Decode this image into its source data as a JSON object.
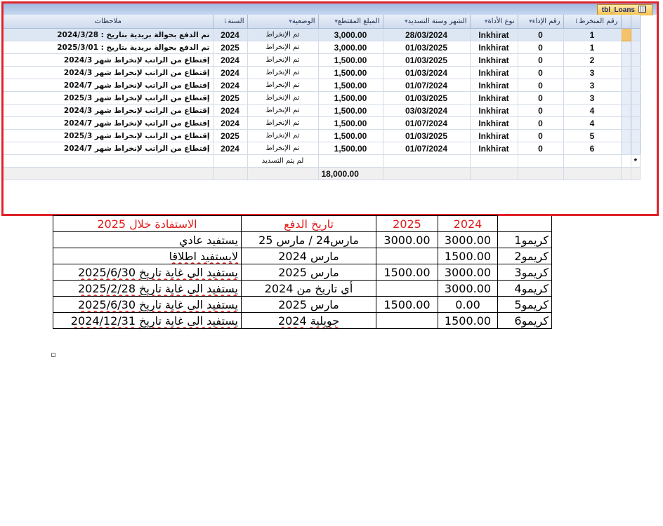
{
  "access": {
    "tab_title": "tbl_Loans",
    "columns": [
      "ملاحظات",
      "السنة",
      "الوضعية",
      "المبلغ المقتطع",
      "الشهر وسنة التسديد",
      "نوع الأداة",
      "رقم الإداء",
      "رقم المنخرط"
    ],
    "rows": [
      {
        "note": "تم الدفع بحوالة بريدية بتاريخ : 2024/3/28",
        "year": "2024",
        "status": "تم الإنخراط",
        "amount": "3,000.00",
        "date": "28/03/2024",
        "type": "Inkhirat",
        "payno": "0",
        "member": "1"
      },
      {
        "note": "تم الدفع بحوالة بريدية بتاريخ : 2025/3/01",
        "year": "2025",
        "status": "تم الإنخراط",
        "amount": "3,000.00",
        "date": "01/03/2025",
        "type": "Inkhirat",
        "payno": "0",
        "member": "1"
      },
      {
        "note": "إقتطاع من الراتب لإنخراط شهر 2024/3",
        "year": "2024",
        "status": "تم الإنخراط",
        "amount": "1,500.00",
        "date": "01/03/2025",
        "type": "Inkhirat",
        "payno": "0",
        "member": "2"
      },
      {
        "note": "إقتطاع من الراتب لإنخراط شهر 2024/3",
        "year": "2024",
        "status": "تم الإنخراط",
        "amount": "1,500.00",
        "date": "01/03/2024",
        "type": "Inkhirat",
        "payno": "0",
        "member": "3"
      },
      {
        "note": "إقتطاع من الراتب لإنخراط شهر 2024/7",
        "year": "2024",
        "status": "تم الإنخراط",
        "amount": "1,500.00",
        "date": "01/07/2024",
        "type": "Inkhirat",
        "payno": "0",
        "member": "3"
      },
      {
        "note": "إقتطاع من الراتب لإنخراط شهر 2025/3",
        "year": "2025",
        "status": "تم الإنخراط",
        "amount": "1,500.00",
        "date": "01/03/2025",
        "type": "Inkhirat",
        "payno": "0",
        "member": "3"
      },
      {
        "note": "إقتطاع من الراتب لإنخراط شهر 2024/3",
        "year": "2024",
        "status": "تم الإنخراط",
        "amount": "1,500.00",
        "date": "03/03/2024",
        "type": "Inkhirat",
        "payno": "0",
        "member": "4"
      },
      {
        "note": "إقتطاع من الراتب لإنخراط شهر 2024/7",
        "year": "2024",
        "status": "تم الإنخراط",
        "amount": "1,500.00",
        "date": "01/07/2024",
        "type": "Inkhirat",
        "payno": "0",
        "member": "4"
      },
      {
        "note": "إقتطاع من الراتب لإنخراط شهر 2025/3",
        "year": "2025",
        "status": "تم الإنخراط",
        "amount": "1,500.00",
        "date": "01/03/2025",
        "type": "Inkhirat",
        "payno": "0",
        "member": "5"
      },
      {
        "note": "إقتطاع من الراتب لإنخراط شهر 2024/7",
        "year": "2024",
        "status": "تم الإنخراط",
        "amount": "1,500.00",
        "date": "01/07/2024",
        "type": "Inkhirat",
        "payno": "0",
        "member": "6"
      }
    ],
    "new_row_status": "لم يتم التسديد",
    "new_row_marker": "*",
    "total": "18,000.00"
  },
  "word_table": {
    "headers": [
      "الاستفادة خلال 2025",
      "تاريخ الدفع",
      "2025",
      "2024",
      ""
    ],
    "rows": [
      {
        "benefit": "يستفيد عادي",
        "paydate": "مارس24  /  مارس 25",
        "y2025": "3000.00",
        "y2024": "3000.00",
        "name": "كريمو1"
      },
      {
        "benefit": "لايستفيد اطلاقا",
        "paydate": "مارس 2024",
        "y2025": "",
        "y2024": "1500.00",
        "name": "كريمو2"
      },
      {
        "benefit": "يستفيد الى غاية تاريخ 2025/6/30",
        "paydate": "مارس 2025",
        "y2025": "1500.00",
        "y2024": "3000.00",
        "name": "كريمو3"
      },
      {
        "benefit": "يستفيد الى غاية تاريخ 2025/2/28",
        "paydate": "أي تاريخ من 2024",
        "y2025": "",
        "y2024": "3000.00",
        "name": "كريمو4"
      },
      {
        "benefit": "يستفيد الى غاية تاريخ 2025/6/30",
        "paydate": "مارس 2025",
        "y2025": "1500.00",
        "y2024": "0.00",
        "name": "كريمو5"
      },
      {
        "benefit": "يستفيد الى غاية تاريخ 2024/12/31",
        "paydate": "جويلية 2024",
        "y2025": "",
        "y2024": "1500.00",
        "name": "كريمو6"
      }
    ]
  },
  "colors": {
    "highlight_border": "#e0222a",
    "header_red": "#e01b1b",
    "selected_cell": "#f5c26b"
  }
}
